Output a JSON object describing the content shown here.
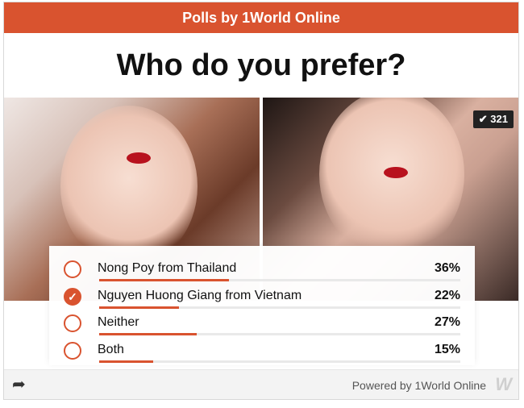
{
  "header": {
    "title": "Polls by 1World Online"
  },
  "question": "Who do you prefer?",
  "vote_count": "✔ 321",
  "options": [
    {
      "label": "Nong Poy from Thailand",
      "percent": "36%",
      "fraction": 0.36,
      "selected": false
    },
    {
      "label": "Nguyen Huong Giang from Vietnam",
      "percent": "22%",
      "fraction": 0.22,
      "selected": true
    },
    {
      "label": "Neither",
      "percent": "27%",
      "fraction": 0.27,
      "selected": false
    },
    {
      "label": "Both",
      "percent": "15%",
      "fraction": 0.15,
      "selected": false
    }
  ],
  "footer": {
    "powered_by": "Powered by 1World Online",
    "logo_text": "W",
    "share_icon": "share-arrow-icon"
  },
  "colors": {
    "accent": "#d9532f",
    "text": "#111111"
  }
}
